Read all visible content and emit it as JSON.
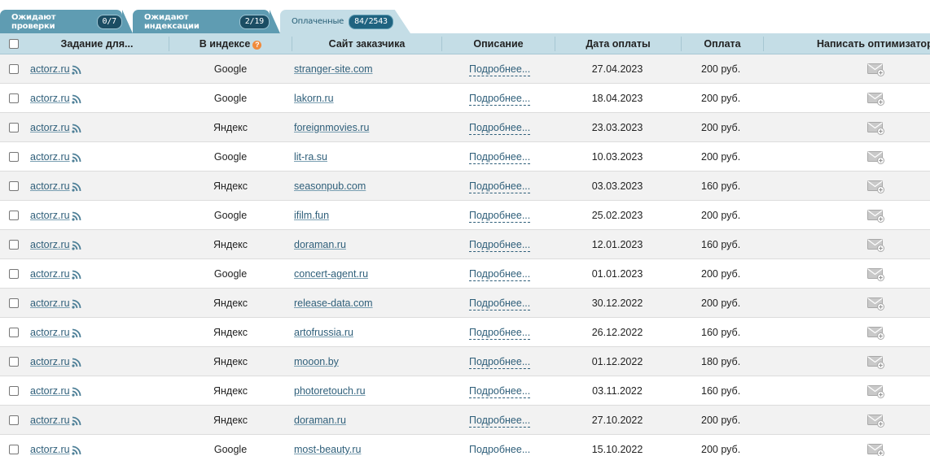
{
  "tabs": [
    {
      "label": "Ожидают проверки",
      "count": "0/7"
    },
    {
      "label": "Ожидают индексации",
      "count": "2/19"
    },
    {
      "label": "Оплаченные",
      "count": "84/2543"
    }
  ],
  "columns": {
    "task": "Задание для...",
    "index": "В индексе",
    "site": "Сайт заказчика",
    "description": "Описание",
    "date": "Дата оплаты",
    "payment": "Оплата",
    "write": "Написать оптимизатору"
  },
  "rows": [
    {
      "task": "actorz.ru",
      "index": "Google",
      "site": "stranger-site.com",
      "description": "Подробнее...",
      "date": "27.04.2023",
      "payment": "200 руб."
    },
    {
      "task": "actorz.ru",
      "index": "Google",
      "site": "lakorn.ru",
      "description": "Подробнее...",
      "date": "18.04.2023",
      "payment": "200 руб."
    },
    {
      "task": "actorz.ru",
      "index": "Яндекс",
      "site": "foreignmovies.ru",
      "description": "Подробнее...",
      "date": "23.03.2023",
      "payment": "200 руб."
    },
    {
      "task": "actorz.ru",
      "index": "Google",
      "site": "lit-ra.su",
      "description": "Подробнее...",
      "date": "10.03.2023",
      "payment": "200 руб."
    },
    {
      "task": "actorz.ru",
      "index": "Яндекс",
      "site": "seasonpub.com",
      "description": "Подробнее...",
      "date": "03.03.2023",
      "payment": "160 руб."
    },
    {
      "task": "actorz.ru",
      "index": "Google",
      "site": "ifilm.fun",
      "description": "Подробнее...",
      "date": "25.02.2023",
      "payment": "200 руб."
    },
    {
      "task": "actorz.ru",
      "index": "Яндекс",
      "site": "doraman.ru",
      "description": "Подробнее...",
      "date": "12.01.2023",
      "payment": "160 руб."
    },
    {
      "task": "actorz.ru",
      "index": "Google",
      "site": "concert-agent.ru",
      "description": "Подробнее...",
      "date": "01.01.2023",
      "payment": "200 руб."
    },
    {
      "task": "actorz.ru",
      "index": "Яндекс",
      "site": "release-data.com",
      "description": "Подробнее...",
      "date": "30.12.2022",
      "payment": "200 руб."
    },
    {
      "task": "actorz.ru",
      "index": "Яндекс",
      "site": "artofrussia.ru",
      "description": "Подробнее...",
      "date": "26.12.2022",
      "payment": "160 руб."
    },
    {
      "task": "actorz.ru",
      "index": "Яндекс",
      "site": "mooon.by",
      "description": "Подробнее...",
      "date": "01.12.2022",
      "payment": "180 руб."
    },
    {
      "task": "actorz.ru",
      "index": "Яндекс",
      "site": "photoretouch.ru",
      "description": "Подробнее...",
      "date": "03.11.2022",
      "payment": "160 руб."
    },
    {
      "task": "actorz.ru",
      "index": "Яндекс",
      "site": "doraman.ru",
      "description": "Подробнее...",
      "date": "27.10.2022",
      "payment": "200 руб."
    },
    {
      "task": "actorz.ru",
      "index": "Google",
      "site": "most-beauty.ru",
      "description": "Подробнее...",
      "date": "15.10.2022",
      "payment": "200 руб."
    }
  ],
  "icons": {
    "rss": "rss-icon",
    "mail": "mail-add-icon",
    "help": "help-icon"
  },
  "colors": {
    "tab_active_bg": "#c4dde6",
    "tab_bg": "#5f9cb2",
    "badge_bg": "#1b4d63",
    "help": "#f08a3c",
    "link": "#2f5f7a"
  }
}
